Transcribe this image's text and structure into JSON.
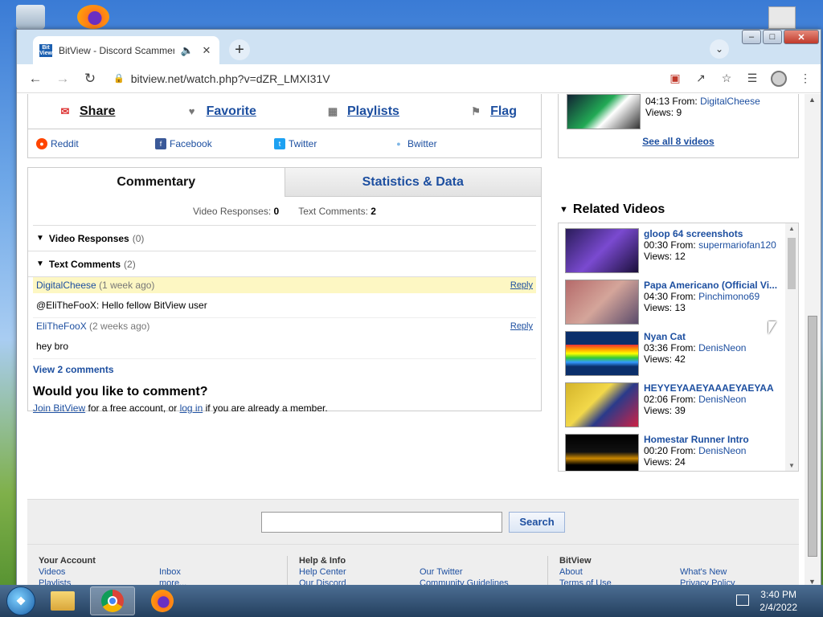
{
  "browser": {
    "tab_title": "BitView - Discord Scammer T",
    "favicon_text": "Bit View",
    "url": "bitview.net/watch.php?v=dZR_LMXI31V"
  },
  "share": {
    "actions": [
      {
        "label": "Share",
        "icon": "envelope-icon"
      },
      {
        "label": "Favorite",
        "icon": "heart-icon"
      },
      {
        "label": "Playlists",
        "icon": "playlist-icon"
      },
      {
        "label": "Flag",
        "icon": "flag-icon"
      }
    ],
    "socials": [
      {
        "label": "Reddit",
        "color": "#ff4500"
      },
      {
        "label": "Facebook",
        "color": "#3b5998"
      },
      {
        "label": "Twitter",
        "color": "#1da1f2"
      },
      {
        "label": "Bwitter",
        "color": "#7fb7e6"
      }
    ]
  },
  "comments": {
    "tab_active": "Commentary",
    "tab_other": "Statistics & Data",
    "video_responses_label": "Video Responses:",
    "video_responses_count": "0",
    "text_comments_label": "Text Comments:",
    "text_comments_count": "2",
    "section_video_responses": "Video Responses",
    "section_video_responses_count": "(0)",
    "section_text_comments": "Text Comments",
    "section_text_comments_count": "(2)",
    "items": [
      {
        "author": "DigitalCheese",
        "age": "(1 week ago)",
        "text": "@EliTheFooX: Hello fellow BitView user",
        "reply": "Reply"
      },
      {
        "author": "EliTheFooX",
        "age": "(2 weeks ago)",
        "text": "hey bro",
        "reply": "Reply"
      }
    ],
    "view_all": "View 2 comments",
    "ask": "Would you like to comment?",
    "join_link": "Join BitView",
    "join_mid": " for a free account, or ",
    "login_link": "log in",
    "join_end": " if you are already a member."
  },
  "playlist_box": {
    "time": "04:13",
    "from_label": "From:",
    "author": "DigitalCheese",
    "views": "Views: 9",
    "see_all": "See all 8 videos"
  },
  "related": {
    "title": "Related Videos",
    "items": [
      {
        "title": "gloop 64 screenshots",
        "time": "00:30",
        "author": "supermariofan120",
        "views": "Views: 12"
      },
      {
        "title": "Papa Americano (Official Vi...",
        "time": "04:30",
        "author": "Pinchimono69",
        "views": "Views: 13"
      },
      {
        "title": "Nyan Cat",
        "time": "03:36",
        "author": "DenisNeon",
        "views": "Views: 42"
      },
      {
        "title": "HEYYEYAAEYAAAEYAEYAA",
        "time": "02:06",
        "author": "DenisNeon",
        "views": "Views: 39"
      },
      {
        "title": "Homestar Runner Intro",
        "time": "00:20",
        "author": "DenisNeon",
        "views": "Views: 24"
      }
    ],
    "from_label": "From:"
  },
  "footer": {
    "search_button": "Search",
    "col1_title": "Your Account",
    "col1": [
      "Videos",
      "Inbox",
      "Playlists",
      "more..."
    ],
    "col2_title": "Help & Info",
    "col2": [
      "Help Center",
      "Our Twitter",
      "Our Discord",
      "Community Guidelines"
    ],
    "col3_title": "BitView",
    "col3": [
      "About",
      "What's New",
      "Terms of Use",
      "Privacy Policy"
    ]
  },
  "taskbar": {
    "time": "3:40 PM",
    "date": "2/4/2022"
  }
}
